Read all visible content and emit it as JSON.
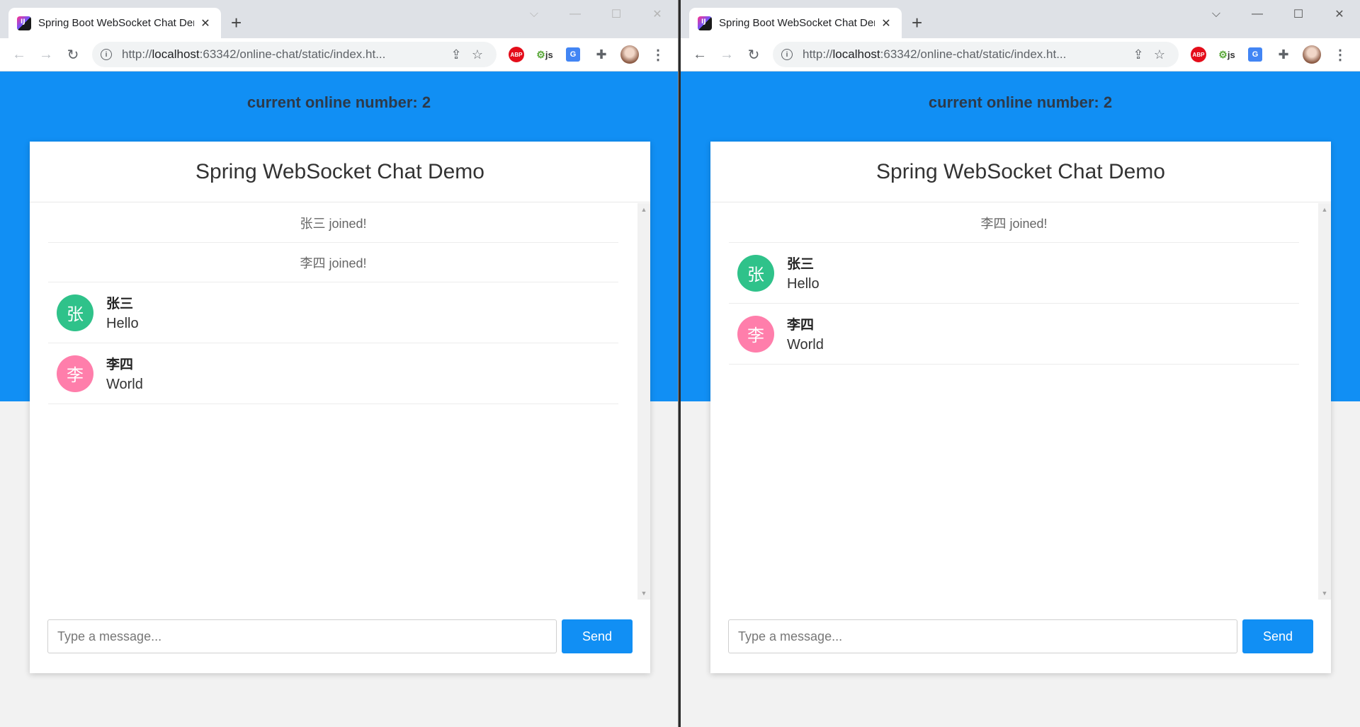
{
  "colors": {
    "accent": "#118ff4",
    "avatar_zhang": "#2fc28a",
    "avatar_li": "#ff7eab"
  },
  "left": {
    "tab": {
      "title": "Spring Boot WebSocket Chat Demo",
      "close": "✕"
    },
    "url": {
      "prefix": "http://",
      "host": "localhost",
      "rest": ":63342/online-chat/static/index.ht..."
    },
    "online_label": "current online number: 2",
    "card_title": "Spring WebSocket Chat Demo",
    "system_messages": [
      "张三 joined!",
      "李四 joined!"
    ],
    "messages": [
      {
        "avatar": "张",
        "sender": "张三",
        "text": "Hello",
        "color": "#2fc28a"
      },
      {
        "avatar": "李",
        "sender": "李四",
        "text": "World",
        "color": "#ff7eab"
      }
    ],
    "input_placeholder": "Type a message...",
    "send_label": "Send"
  },
  "right": {
    "tab": {
      "title": "Spring Boot WebSocket Chat Demo",
      "close": "✕"
    },
    "url": {
      "prefix": "http://",
      "host": "localhost",
      "rest": ":63342/online-chat/static/index.ht..."
    },
    "online_label": "current online number: 2",
    "card_title": "Spring WebSocket Chat Demo",
    "system_messages": [
      "李四 joined!"
    ],
    "messages": [
      {
        "avatar": "张",
        "sender": "张三",
        "text": "Hello",
        "color": "#2fc28a"
      },
      {
        "avatar": "李",
        "sender": "李四",
        "text": "World",
        "color": "#ff7eab"
      }
    ],
    "input_placeholder": "Type a message...",
    "send_label": "Send"
  },
  "icons": {
    "back": "←",
    "forward": "→",
    "reload": "↻",
    "info": "i",
    "share": "⇪",
    "star": "☆",
    "abp": "ABP",
    "js": "js",
    "translate": "G",
    "puzzle": "✚",
    "menu": "⋮",
    "new_tab": "+",
    "chevron": "⌵",
    "minimize": "—",
    "maximize": "☐",
    "close": "✕",
    "scroll_up": "▲",
    "scroll_down": "▼"
  }
}
